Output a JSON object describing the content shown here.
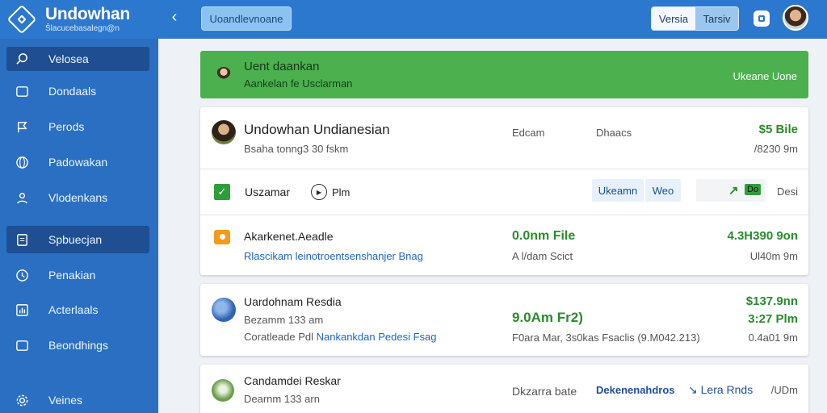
{
  "header": {
    "brand_name": "Undowhan",
    "brand_sub": "Ŝlacucebasalegn@n",
    "search_button": "Uoandlevnoane",
    "seg_left": "Versia",
    "seg_right": "Tarsiv"
  },
  "sidebar": {
    "items": [
      {
        "label": "Velosea",
        "icon": "search-icon"
      },
      {
        "label": "Dondaals",
        "icon": "folder-icon"
      },
      {
        "label": "Perods",
        "icon": "flag-icon"
      },
      {
        "label": "Padowakan",
        "icon": "globe-icon"
      },
      {
        "label": "Vlodenkans",
        "icon": "person-icon"
      },
      {
        "label": "Spbuecjan",
        "icon": "document-icon"
      },
      {
        "label": "Penakian",
        "icon": "clock-icon"
      },
      {
        "label": "Acterlaals",
        "icon": "chart-icon"
      },
      {
        "label": "Beondhings",
        "icon": "folder-icon"
      },
      {
        "label": "Veines",
        "icon": "gear-icon"
      }
    ]
  },
  "banner": {
    "title": "Uent daankan",
    "subtitle": "Aankelan fe Usclarman",
    "action": "Ukeane Uone"
  },
  "card1": {
    "title": "Undowhan Undianesian",
    "subtitle": "Bsaha tonng3 30 fskm",
    "col1": "Edcam",
    "col2": "Dhaacs",
    "amount": "$5 Bile",
    "time": "/8230 9m",
    "row2_label": "Uszamar",
    "row2_play": "Plm",
    "pill1": "Ukeamn",
    "pill2": "Weo",
    "badge": "Do",
    "row2_end": "Desi"
  },
  "card1b": {
    "title": "Akarkenet.Aeadle",
    "link": "Rlascikam leinotroentsenshanjer Bnag",
    "mid_value": "0.0nm File",
    "mid_sub": "A l/dam Scict",
    "amount": "4.3H390 9on",
    "time": "Ul40m 9m"
  },
  "card2": {
    "title": "Uardohnam Resdia",
    "sub": "Bezamm 133 am",
    "line_prefix": "Coratleade Pdl",
    "line_link": "Nankankdan Pedesi Fsag",
    "mid_value": "9.0Am Fr2)",
    "mid_sub": "F0ara Mar, 3s0kas Fsaclis (9.M042.213)",
    "amount": "$137.9nn",
    "time": "3:27 Plm",
    "time2": "0.4a01 9m"
  },
  "card3": {
    "title": "Candamdei Reskar",
    "sub": "Dearnm 133 arn",
    "mid": "Dkzarra bate",
    "link1": "Dekenenahdros",
    "link2": "Lera Rnds",
    "end": "/UDm"
  },
  "colors": {
    "header": "#2d78cf",
    "sidebar": "#2b6fc2",
    "banner": "#4cb04f",
    "accent_green": "#2a8b2e",
    "accent_blue": "#1f66c1"
  }
}
